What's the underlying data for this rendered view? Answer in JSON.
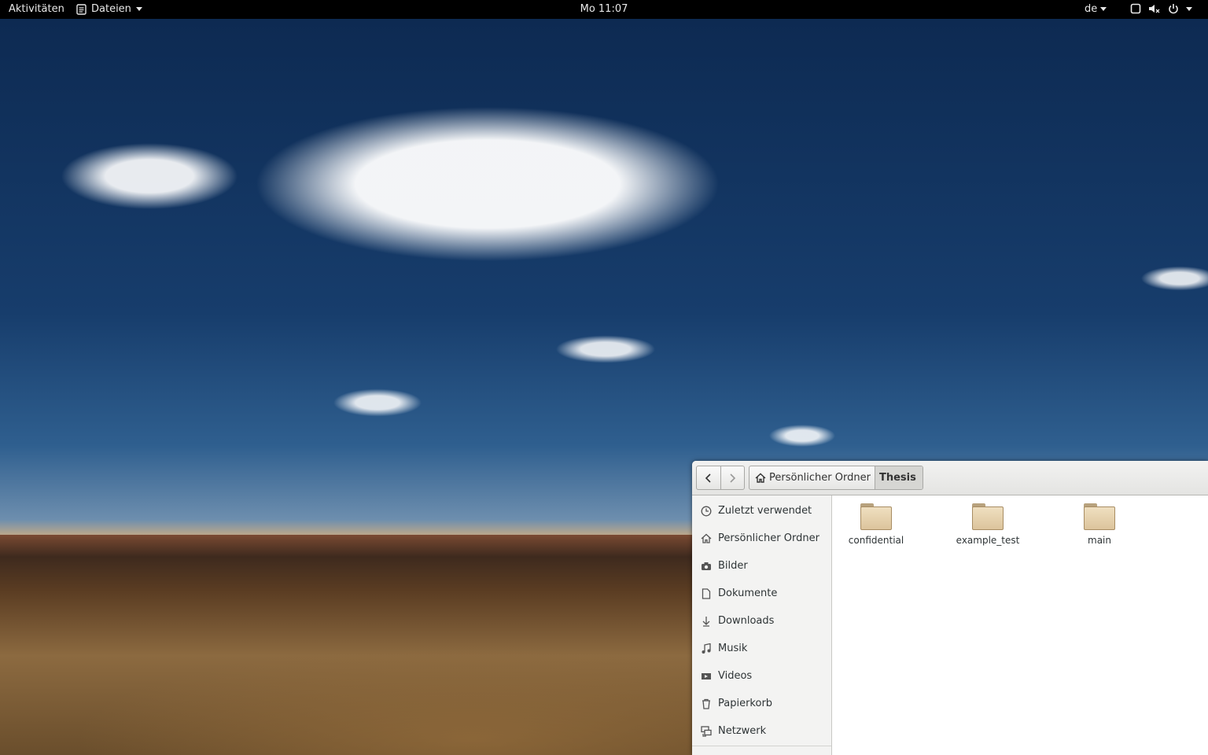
{
  "topbar": {
    "activities": "Aktivitäten",
    "app_menu": "Dateien",
    "clock": "Mo 11:07",
    "keyboard_layout": "de"
  },
  "file_manager": {
    "breadcrumbs": [
      {
        "label": "Persönlicher Ordner",
        "icon": "home-icon"
      },
      {
        "label": "Thesis"
      }
    ],
    "sidebar": [
      {
        "label": "Zuletzt verwendet",
        "icon": "clock-icon"
      },
      {
        "label": "Persönlicher Ordner",
        "icon": "home-icon"
      },
      {
        "label": "Bilder",
        "icon": "camera-icon"
      },
      {
        "label": "Dokumente",
        "icon": "document-icon"
      },
      {
        "label": "Downloads",
        "icon": "download-icon"
      },
      {
        "label": "Musik",
        "icon": "music-icon"
      },
      {
        "label": "Videos",
        "icon": "video-icon"
      },
      {
        "label": "Papierkorb",
        "icon": "trash-icon"
      },
      {
        "label": "Netzwerk",
        "icon": "network-icon"
      }
    ],
    "folders": [
      {
        "name": "confidential"
      },
      {
        "name": "example_test"
      },
      {
        "name": "main"
      }
    ]
  }
}
